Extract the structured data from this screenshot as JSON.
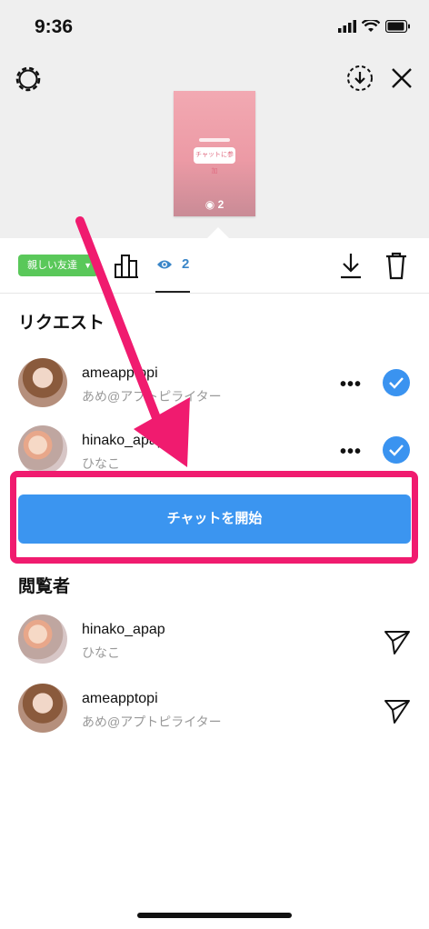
{
  "status_bar": {
    "time": "9:36"
  },
  "story_preview": {
    "sticker_text": "チャットに参加",
    "view_count": "2"
  },
  "toolbar": {
    "close_friends_label": "親しい友達",
    "view_count": "2"
  },
  "requests": {
    "title": "リクエスト",
    "items": [
      {
        "username": "ameapptopi",
        "name": "あめ@アプトピライター",
        "more": "•••"
      },
      {
        "username": "hinako_apap",
        "name": "ひなこ",
        "more": "•••"
      }
    ]
  },
  "cta": {
    "label": "チャットを開始"
  },
  "viewers": {
    "title": "閲覧者",
    "items": [
      {
        "username": "hinako_apap",
        "name": "ひなこ"
      },
      {
        "username": "ameapptopi",
        "name": "あめ@アプトピライター"
      }
    ]
  },
  "colors": {
    "accent_blue": "#3b95f0",
    "highlight_pink": "#f01b6f",
    "close_friends_green": "#5ac85a"
  }
}
